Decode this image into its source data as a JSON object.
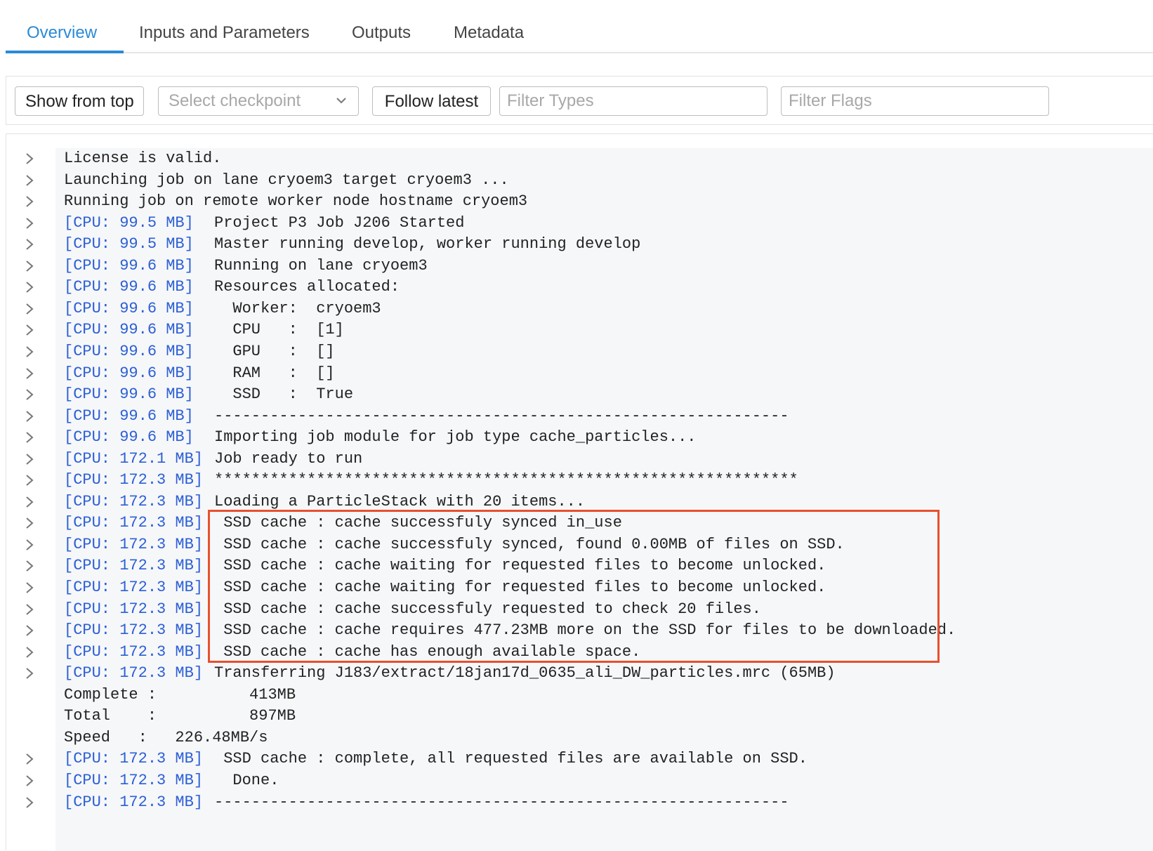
{
  "tabs": [
    {
      "label": "Overview",
      "active": true
    },
    {
      "label": "Inputs and Parameters",
      "active": false
    },
    {
      "label": "Outputs",
      "active": false
    },
    {
      "label": "Metadata",
      "active": false
    }
  ],
  "toolbar": {
    "show_from_top": "Show from top",
    "checkpoint_placeholder": "Select checkpoint",
    "follow_latest": "Follow latest",
    "filter_types_placeholder": "Filter Types",
    "filter_flags_placeholder": "Filter Flags"
  },
  "colors": {
    "accent": "#2b8ad6",
    "cpu_tag": "#2c5fd6",
    "highlight_border": "#e8502e"
  },
  "log": [
    {
      "cpu": "",
      "msg": "License is valid.",
      "expandable": true
    },
    {
      "cpu": "",
      "msg": "Launching job on lane cryoem3 target cryoem3 ...",
      "expandable": true
    },
    {
      "cpu": "",
      "msg": "Running job on remote worker node hostname cryoem3",
      "expandable": true
    },
    {
      "cpu": "[CPU: 99.5 MB]",
      "msg": "Project P3 Job J206 Started",
      "expandable": true
    },
    {
      "cpu": "[CPU: 99.5 MB]",
      "msg": "Master running develop, worker running develop",
      "expandable": true
    },
    {
      "cpu": "[CPU: 99.6 MB]",
      "msg": "Running on lane cryoem3",
      "expandable": true
    },
    {
      "cpu": "[CPU: 99.6 MB]",
      "msg": "Resources allocated:",
      "expandable": true
    },
    {
      "cpu": "[CPU: 99.6 MB]",
      "msg": "  Worker:  cryoem3",
      "expandable": true
    },
    {
      "cpu": "[CPU: 99.6 MB]",
      "msg": "  CPU   :  [1]",
      "expandable": true
    },
    {
      "cpu": "[CPU: 99.6 MB]",
      "msg": "  GPU   :  []",
      "expandable": true
    },
    {
      "cpu": "[CPU: 99.6 MB]",
      "msg": "  RAM   :  []",
      "expandable": true
    },
    {
      "cpu": "[CPU: 99.6 MB]",
      "msg": "  SSD   :  True",
      "expandable": true
    },
    {
      "cpu": "[CPU: 99.6 MB]",
      "msg": "--------------------------------------------------------------",
      "expandable": true
    },
    {
      "cpu": "[CPU: 99.6 MB]",
      "msg": "Importing job module for job type cache_particles...",
      "expandable": true
    },
    {
      "cpu": "[CPU: 172.1 MB]",
      "msg": "Job ready to run",
      "expandable": true
    },
    {
      "cpu": "[CPU: 172.3 MB]",
      "msg": "***************************************************************",
      "expandable": true
    },
    {
      "cpu": "[CPU: 172.3 MB]",
      "msg": "Loading a ParticleStack with 20 items...",
      "expandable": true
    },
    {
      "cpu": "[CPU: 172.3 MB]",
      "msg": " SSD cache : cache successfuly synced in_use",
      "expandable": true
    },
    {
      "cpu": "[CPU: 172.3 MB]",
      "msg": " SSD cache : cache successfuly synced, found 0.00MB of files on SSD.",
      "expandable": true
    },
    {
      "cpu": "[CPU: 172.3 MB]",
      "msg": " SSD cache : cache waiting for requested files to become unlocked.",
      "expandable": true
    },
    {
      "cpu": "[CPU: 172.3 MB]",
      "msg": " SSD cache : cache waiting for requested files to become unlocked.",
      "expandable": true
    },
    {
      "cpu": "[CPU: 172.3 MB]",
      "msg": " SSD cache : cache successfuly requested to check 20 files.",
      "expandable": true
    },
    {
      "cpu": "[CPU: 172.3 MB]",
      "msg": " SSD cache : cache requires 477.23MB more on the SSD for files to be downloaded.",
      "expandable": true
    },
    {
      "cpu": "[CPU: 172.3 MB]",
      "msg": " SSD cache : cache has enough available space.",
      "expandable": true
    },
    {
      "cpu": "[CPU: 172.3 MB]",
      "msg": "Transferring J183/extract/18jan17d_0635_ali_DW_particles.mrc (65MB)",
      "expandable": true
    },
    {
      "cpu": "",
      "msg": "Complete :          413MB",
      "expandable": false
    },
    {
      "cpu": "",
      "msg": "Total    :          897MB",
      "expandable": false
    },
    {
      "cpu": "",
      "msg": "Speed   :   226.48MB/s",
      "expandable": false
    },
    {
      "cpu": "[CPU: 172.3 MB]",
      "msg": " SSD cache : complete, all requested files are available on SSD.",
      "expandable": true
    },
    {
      "cpu": "[CPU: 172.3 MB]",
      "msg": "  Done.",
      "expandable": true
    },
    {
      "cpu": "[CPU: 172.3 MB]",
      "msg": "--------------------------------------------------------------",
      "expandable": true
    }
  ]
}
